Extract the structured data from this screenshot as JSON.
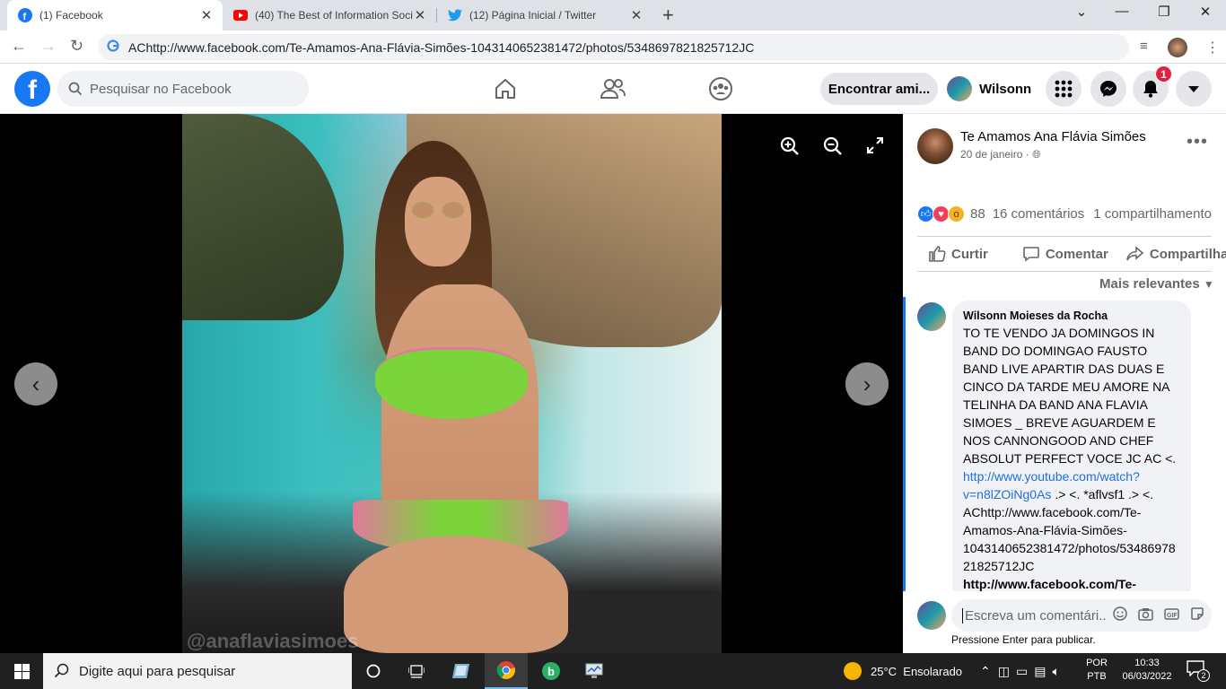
{
  "browser": {
    "tabs": [
      {
        "title": "(1) Facebook",
        "icon": "facebook-icon"
      },
      {
        "title": "(40) The Best of Information Soci",
        "icon": "youtube-icon"
      },
      {
        "title": "(12) Página Inicial / Twitter",
        "icon": "twitter-icon"
      }
    ],
    "url": "AChttp://www.facebook.com/Te-Amamos-Ana-Flávia-Simões-1043140652381472/photos/5348697821825712JC"
  },
  "facebook": {
    "search_placeholder": "Pesquisar no Facebook",
    "find_friends": "Encontrar ami...",
    "user_name": "Wilsonn",
    "notification_count": "1"
  },
  "viewer": {
    "watermark": "@anaflaviasimoes"
  },
  "post": {
    "page_name": "Te Amamos Ana Flávia Simões",
    "date": "20 de janeiro ·",
    "reactions_count": "88",
    "comments": "16 comentários",
    "shares": "1 compartilhamento",
    "like_label": "Curtir",
    "comment_label": "Comentar",
    "share_label": "Compartilhar",
    "sort_label": "Mais relevantes"
  },
  "comment": {
    "author": "Wilsonn Moieses da Rocha",
    "text_1": "TO TE VENDO JA DOMINGOS IN BAND DO DOMINGAO FAUSTO BAND LIVE APARTIR DAS DUAS E CINCO DA TARDE MEU AMORE NA TELINHA DA BAND ANA FLAVIA SIMOES _ BREVE AGUARDEM E NOS CANNONGOOD AND CHEF ABSOLUT PERFECT VOCE JC AC <.",
    "link_1": "http://www.youtube.com/watch?v=n8lZOiNg0As",
    "text_2": " .> <. *aflvsf1 .> <. AChttp://www.facebook.com/Te-Amamos-Ana-Flávia-Simões-1043140652381472/photos/5348697821825712JC",
    "link_2": "http://www.facebook.com/Te-"
  },
  "compose": {
    "placeholder": "Escreva um comentári...",
    "hint": "Pressione Enter para publicar."
  },
  "taskbar": {
    "search_placeholder": "Digite aqui para pesquisar",
    "weather": "25°C  Ensolarado",
    "lang_1": "POR",
    "lang_2": "PTB",
    "time": "10:33",
    "date": "06/03/2022",
    "notif_count": "2"
  }
}
